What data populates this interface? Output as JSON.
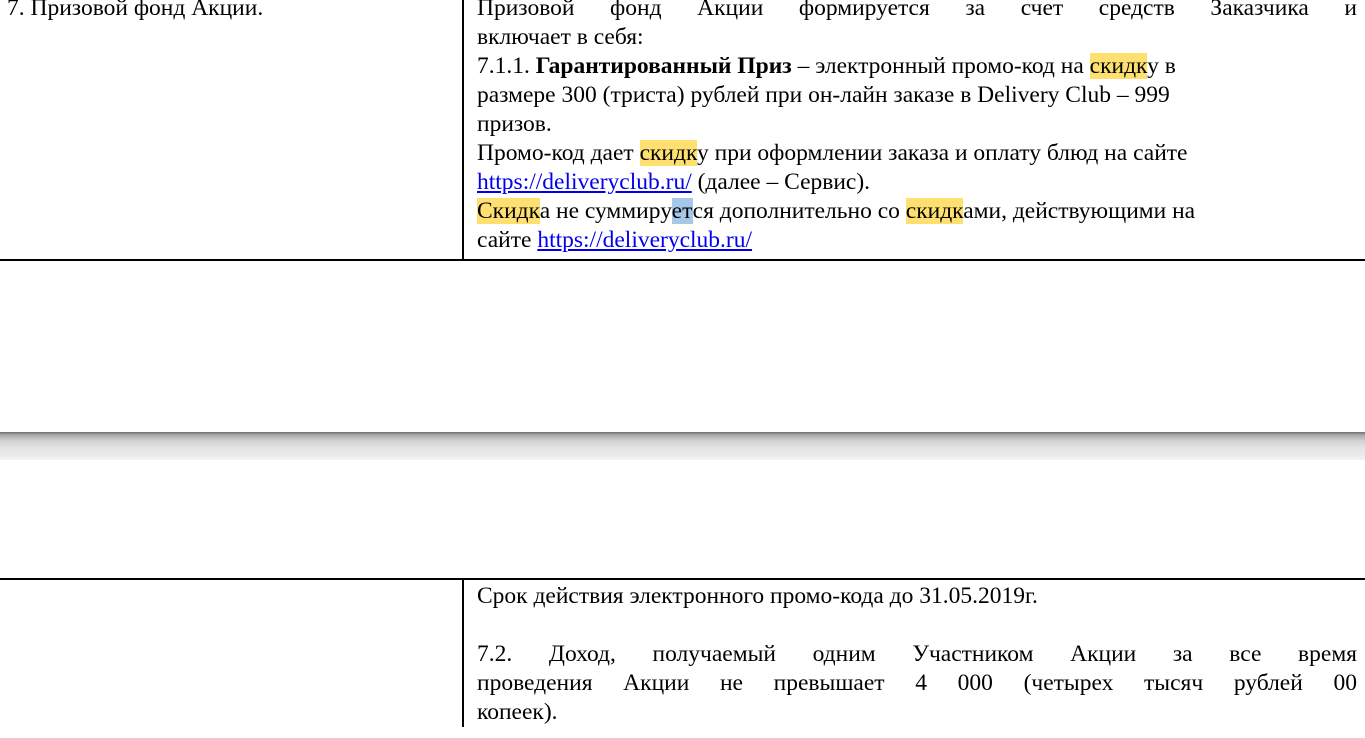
{
  "top_section": {
    "left_heading": "7. Призовой фонд Акции.",
    "intro_line1": "Призовой фонд Акции формируется за счет средств Заказчика и",
    "intro_line2": "включает в себя:",
    "prize_number": "7.1.1.",
    "prize_title": "Гарантированный Приз",
    "prize_text1": " – электронный промо-код на ",
    "highlight_word": "скидк",
    "prize_text1_end": "у в",
    "prize_text2": "размере 300 (триста) рублей при он-лайн заказе в Delivery Club – 999",
    "prize_text3": "призов.",
    "promo_text1_start": "Промо-код дает ",
    "promo_text1_end": "у при оформлении заказа и оплату блюд на сайте",
    "promo_link": "https://deliveryclub.ru/",
    "promo_text2_end": " (далее – Сервис).",
    "discount_word": "Скидк",
    "discount_text_a": "а не суммиру",
    "selected_text": "ет",
    "discount_text_b": "ся дополнительно со ",
    "discount_text_c": "ами, действующими на",
    "site_word": "сайте ",
    "site_link": "https://deliveryclub.ru/"
  },
  "bottom_section": {
    "validity": "Срок действия электронного промо-кода до 31.05.2019г.",
    "income_line1": "7.2. Доход, получаемый одним Участником Акции за все время",
    "income_line2": "проведения Акции не превышает 4 000 (четырех тысяч рублей 00",
    "income_line3": "копеек)."
  },
  "colors": {
    "highlight": "#fde070",
    "selection": "#a6c8e8",
    "link": "#0000ee"
  }
}
